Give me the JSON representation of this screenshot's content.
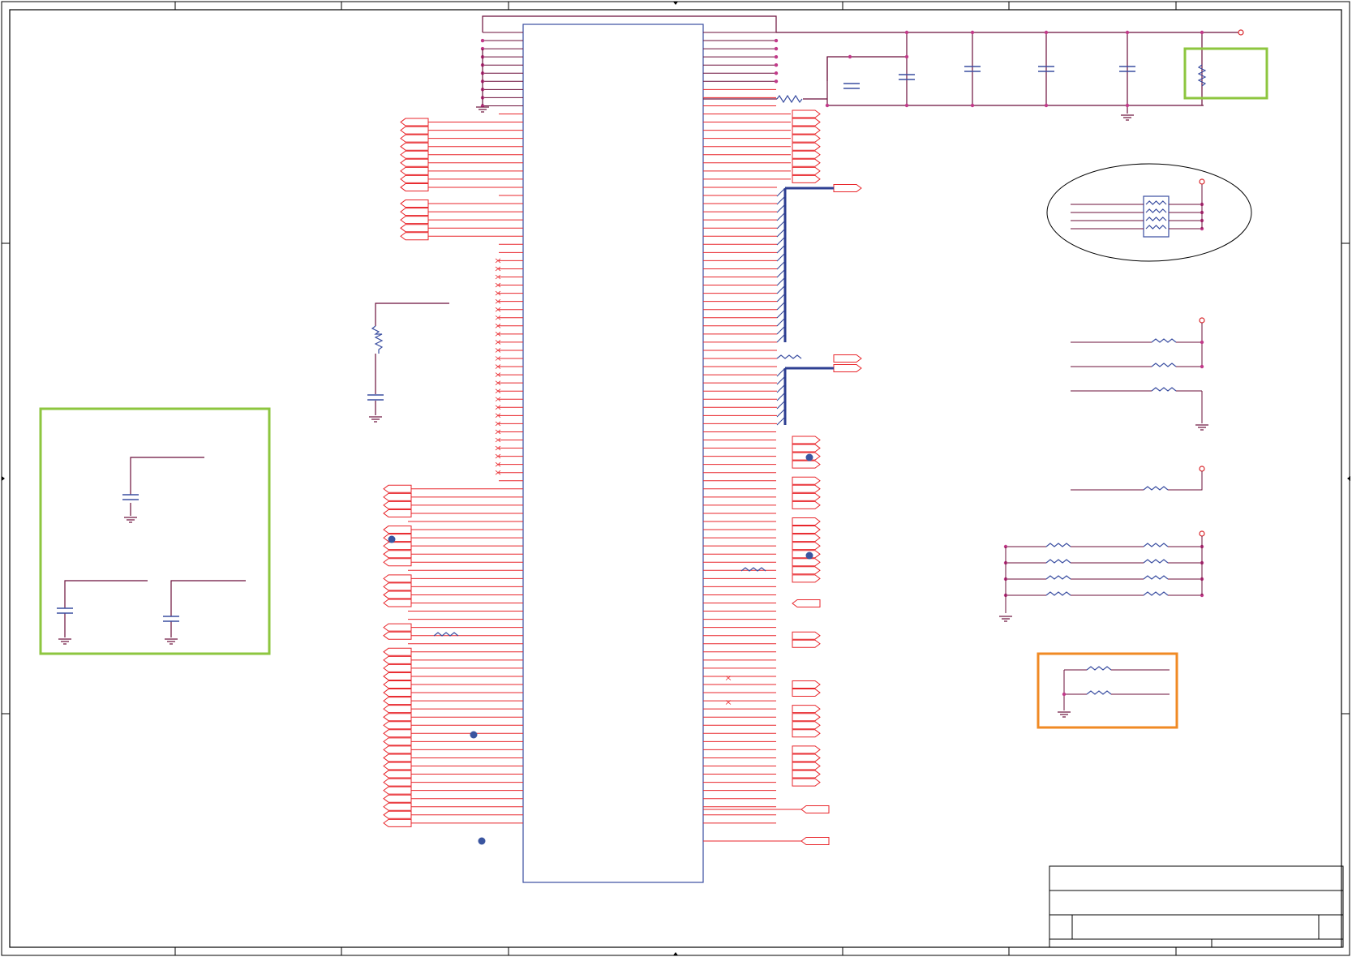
{
  "colors": {
    "page_background": "#ffffff",
    "frame": "#000000",
    "signal_wire": "#e8262b",
    "power_wire": "#6b0f3a",
    "junction": "#c23a8a",
    "component": "#3a4ea1",
    "bus": "#2e3f92",
    "connection_dot": "#3a55a0",
    "power_flag": "#d9262b",
    "highlight_green": "#8dc63f",
    "highlight_orange": "#f08a24",
    "ellipse_outline": "#000000"
  },
  "icons": {
    "ground": "ground-symbol-icon",
    "resistor": "resistor-icon",
    "capacitor": "capacitor-icon",
    "resistor_network": "resistor-array-icon",
    "off_page_connector": "port-flag-icon",
    "no_connect": "no-connect-x-icon",
    "power_rail": "power-rail-circle-icon"
  },
  "highlights": [
    {
      "id": "green-box-resistor",
      "color": "green"
    },
    {
      "id": "green-box-decoupling",
      "color": "green"
    },
    {
      "id": "orange-box-resistors",
      "color": "orange"
    },
    {
      "id": "ellipse-resistor-array",
      "color": "black"
    }
  ],
  "title_block": {
    "title": "",
    "sheet": "",
    "revision": ""
  }
}
